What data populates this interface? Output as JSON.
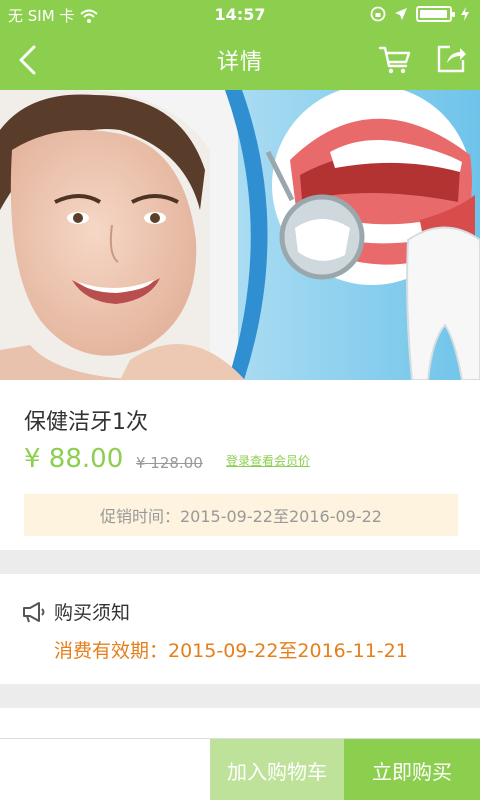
{
  "status_bar": {
    "carrier": "无 SIM 卡",
    "time": "14:57",
    "battery_level": 0.95
  },
  "navbar": {
    "title": "详情",
    "icons": [
      "back-icon",
      "cart-icon",
      "share-icon"
    ]
  },
  "product": {
    "name": "保健洁牙1次",
    "price": "¥ 88.00",
    "original_price": "¥ 128.00",
    "member_price_link": "登录查看会员价",
    "promo_period": "促销时间：2015-09-22至2016-09-22"
  },
  "purchase_notice": {
    "title": "购买须知",
    "validity": "消费有效期：2015-09-22至2016-11-21"
  },
  "bottom_bar": {
    "add_to_cart": "加入购物车",
    "buy_now": "立即购买"
  },
  "colors": {
    "brand_green": "#8ccf4f",
    "light_green": "#bfe29a",
    "validity_orange": "#e57f1c",
    "promo_bg": "#fdf3de"
  }
}
